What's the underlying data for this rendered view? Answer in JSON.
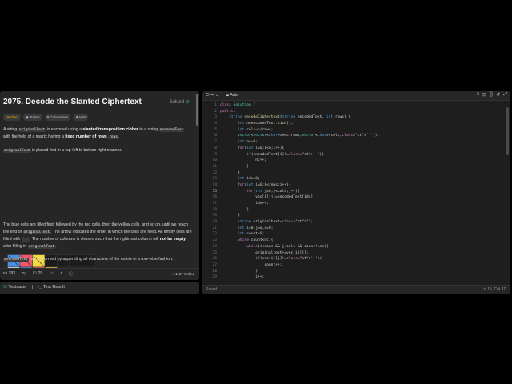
{
  "problem": {
    "title": "2075. Decode the Slanted Ciphertext",
    "solved_label": "Solved",
    "tags": [
      "Medium",
      "Topics",
      "Companies",
      "Hint"
    ],
    "p1": {
      "t1": "A string ",
      "c1": "originalText",
      "t2": " is encoded using a ",
      "b1": "slanted transposition cipher",
      "t3": " to a string ",
      "c2": "encodedText",
      "t4": " with the help of a matrix having a ",
      "b2": "fixed number of rows",
      "c3": "rows",
      "t5": "."
    },
    "p2": {
      "c1": "originalText",
      "t1": " is placed first in a top-left to bottom-right manner."
    },
    "p3": {
      "t1": "The blue cells are filled first, followed by the red cells, then the yellow cells, and so on, until we reach the end of ",
      "c1": "originalText",
      "t2": ". The arrow indicates the order in which the cells are filled. All empty cells are filled with ",
      "c2": "' '",
      "t3": ". The number of columns is chosen such that the rightmost column will ",
      "b1": "not be empty",
      "t4": " after filling in ",
      "c3": "originalText",
      "t5": "."
    },
    "p4": {
      "c1": "encodedText",
      "t1": " is then formed by appending all characters of the matrix in a row-wise fashion."
    },
    "likes": "283",
    "comments": "29",
    "online": "1167 Online"
  },
  "matrix": {
    "rows": [
      [
        "b",
        "r",
        "y",
        "",
        "",
        "",
        "",
        ""
      ],
      [
        "w",
        "b",
        "r",
        "y",
        "",
        "",
        "",
        ""
      ],
      [
        "w",
        "w",
        "b",
        "r",
        "y",
        "",
        "",
        ""
      ],
      [
        "w",
        "w",
        "w",
        "b",
        "r",
        "y",
        "",
        ""
      ]
    ],
    "colors": {
      "b": "#4a90e2",
      "r": "#f0576c",
      "y": "#f5d742",
      "w": "#ffffff",
      "e": "#1c1c1c"
    }
  },
  "bottom": {
    "testcase": "Testcase",
    "result": "Test Result"
  },
  "editor": {
    "language": "C++",
    "mode": "Auto",
    "status": "Saved",
    "cursor": "Ln 15, Col 37",
    "current_line": 15,
    "lines": [
      "class Solution {",
      "public:",
      "    string decodeCiphertext(string encodedText, int rows) {",
      "        int n=encodedText.size();",
      "        int cols=n/rows;",
      "        vector<vector<char>>vec(rows,vector<char>(cols,' '));",
      "        int nc=0;",
      "        for(int i=0;i<n;i++){",
      "            if(encodedText[i]!=' ')(",
      "                nc++;",
      "            }",
      "        }",
      "        int idx=0;",
      "        for(int i=0;i<rows;i++){",
      "            for(int j=0;j<cols;j++){",
      "                vec[i][j]=encodedText[idx];",
      "                idx++;",
      "            }",
      "        }",
      "        string originaltext=\"\";",
      "        int i=0,j=0,c=0;",
      "        int count=0;",
      "        while(count<nc){",
      "            while(i<rows && j<cols && count!=nc){",
      "                originaltext+=vec[i][j];",
      "                if(vec[i][j]!=' ')(",
      "                    count++;",
      "                }",
      "                i++;"
    ]
  }
}
